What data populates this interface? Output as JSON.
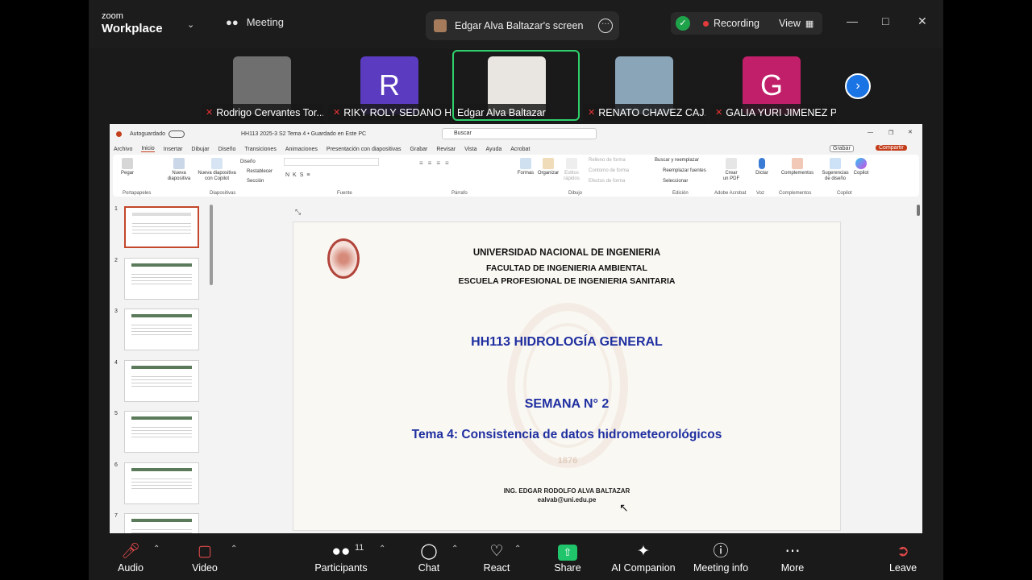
{
  "app": {
    "logo_top": "zoom",
    "logo_bottom": "Workplace"
  },
  "meeting": {
    "label": "Meeting",
    "screen_label": "Edgar Alva Baltazar's screen",
    "recording_label": "Recording",
    "view_label": "View"
  },
  "participants": [
    {
      "name": "Rodrigo Cervantes Tor...",
      "letter": "",
      "color": "#6f6f6f"
    },
    {
      "name": "RIKY ROLY SEDANO H...",
      "letter": "R",
      "color": "#5b3bbf"
    },
    {
      "name": "Edgar Alva Baltazar",
      "letter": "",
      "color": "#e9e6e1"
    },
    {
      "name": "RENATO CHAVEZ CAJ...",
      "letter": "",
      "color": "#8aa4b8"
    },
    {
      "name": "GALIA YURI JIMENEZ P...",
      "letter": "G",
      "color": "#c21f6a"
    }
  ],
  "ppt": {
    "autosave": "Autoguardado",
    "doc_title": "HH113 2025-3 S2 Tema 4 • Guardado en Este PC",
    "search": "Buscar",
    "tabs": [
      "Archivo",
      "Inicio",
      "Insertar",
      "Dibujar",
      "Diseño",
      "Transiciones",
      "Animaciones",
      "Presentación con diapositivas",
      "Grabar",
      "Revisar",
      "Vista",
      "Ayuda",
      "Acrobat"
    ],
    "grabar_btn": "Grabar",
    "compartir_btn": "Compartir",
    "groups": [
      "Portapapeles",
      "Diapositivas",
      "Fuente",
      "Párrafo",
      "Dibujo",
      "Edición",
      "Adobe Acrobat",
      "Voz",
      "Complementos",
      "Copilot"
    ],
    "buttons": {
      "pegar": "Pegar",
      "nueva": "Nueva diapositiva",
      "copilot_slide": "Nueva diapositiva con Copilot",
      "diseno": "Diseño",
      "restablecer": "Restablecer",
      "seccion": "Sección",
      "formas": "Formas",
      "organizar": "Organizar",
      "estilos": "Estilos rápidos",
      "relleno": "Relleno de forma",
      "contorno": "Contorno de forma",
      "efectos": "Efectos de forma",
      "buscar": "Buscar y reemplazar",
      "reemplazar": "Reemplazar fuentes",
      "seleccionar": "Seleccionar",
      "crear_pdf": "Crear un PDF",
      "dictar": "Dictar",
      "complementos": "Complementos",
      "sugerencias": "Sugerencias de diseño",
      "copilot": "Copilot"
    },
    "slide_numbers": [
      "1",
      "2",
      "3",
      "4",
      "5",
      "6",
      "7"
    ]
  },
  "slide": {
    "line1": "UNIVERSIDAD NACIONAL DE INGENIERIA",
    "line2": "FACULTAD DE INGENIERIA AMBIENTAL",
    "line3": "ESCUELA PROFESIONAL DE INGENIERIA SANITARIA",
    "course": "HH113 HIDROLOGÍA GENERAL",
    "week": "SEMANA N° 2",
    "topic": "Tema 4: Consistencia de datos hidrometeorológicos",
    "author": "ING. EDGAR RODOLFO ALVA BALTAZAR",
    "email": "ealvab@uni.edu.pe",
    "seal_year": "1876",
    "title_color": "#1f2fa0"
  },
  "toolbar": {
    "audio": "Audio",
    "video": "Video",
    "participants": "Participants",
    "participants_count": "11",
    "chat": "Chat",
    "react": "React",
    "share": "Share",
    "ai": "AI Companion",
    "info": "Meeting info",
    "more": "More",
    "leave": "Leave"
  }
}
